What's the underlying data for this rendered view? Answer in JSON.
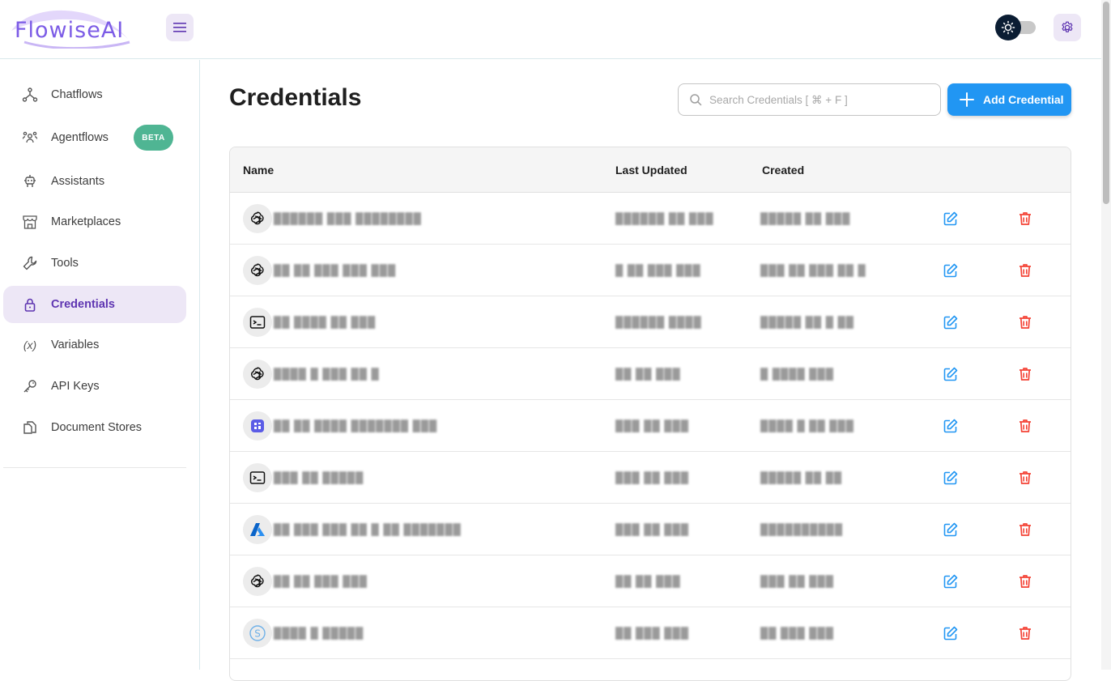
{
  "header": {
    "logo_text": "FlowiseAI"
  },
  "sidebar": {
    "items": [
      {
        "label": "Chatflows",
        "icon": "hierarchy-icon"
      },
      {
        "label": "Agentflows",
        "icon": "users-group-icon",
        "badge": "BETA"
      },
      {
        "label": "Assistants",
        "icon": "robot-icon"
      },
      {
        "label": "Marketplaces",
        "icon": "storefront-icon"
      },
      {
        "label": "Tools",
        "icon": "wrench-icon"
      },
      {
        "label": "Credentials",
        "icon": "lock-icon",
        "active": true
      },
      {
        "label": "Variables",
        "icon": "variable-icon"
      },
      {
        "label": "API Keys",
        "icon": "key-icon"
      },
      {
        "label": "Document Stores",
        "icon": "files-icon"
      }
    ],
    "variables_icon_text": "(x)"
  },
  "main": {
    "title": "Credentials",
    "search_placeholder": "Search Credentials [ ⌘ + F ]",
    "add_button_label": "Add Credential"
  },
  "table": {
    "columns": [
      "Name",
      "Last Updated",
      "Created"
    ],
    "rows": [
      {
        "icon": "openai-icon",
        "name": "██████ ███ ████████",
        "updated": "██████ ██ ███",
        "created": "█████ ██ ███"
      },
      {
        "icon": "openai-icon",
        "name": "██ ██ ███ ███ ███",
        "updated": "█ ██ ███ ███",
        "created": "███ ██ ███ ██ █"
      },
      {
        "icon": "terminal-icon",
        "name": "██ ████ ██ ███",
        "updated": "██████ ████",
        "created": "█████ ██ █ ██"
      },
      {
        "icon": "openai-icon",
        "name": "████ █ ███ ██ █",
        "updated": "██ ██ ███",
        "created": "█ ████ ███"
      },
      {
        "icon": "grid-app-icon",
        "name": "██ ██ ████ ███████ ███",
        "updated": "███ ██ ███",
        "created": "████ █ ██ ███"
      },
      {
        "icon": "terminal-icon",
        "name": "███ ██ █████",
        "updated": "███ ██ ███",
        "created": "█████ ██ ██"
      },
      {
        "icon": "azure-icon",
        "name": "██ ███ ███ ██ █ ██ ███████",
        "updated": "███ ██ ███",
        "created": "██████████"
      },
      {
        "icon": "openai-icon",
        "name": "██ ██ ███ ███",
        "updated": "██ ██ ███",
        "created": "███ ██ ███"
      },
      {
        "icon": "s-circle-icon",
        "name": "████ █ █████",
        "updated": "██ ███ ███",
        "created": "██ ███ ███"
      }
    ]
  },
  "colors": {
    "accent": "#5e35b1",
    "primary_button": "#2196f3",
    "edit": "#2196f3",
    "delete": "#f44336",
    "beta_badge": "#4fb593"
  }
}
